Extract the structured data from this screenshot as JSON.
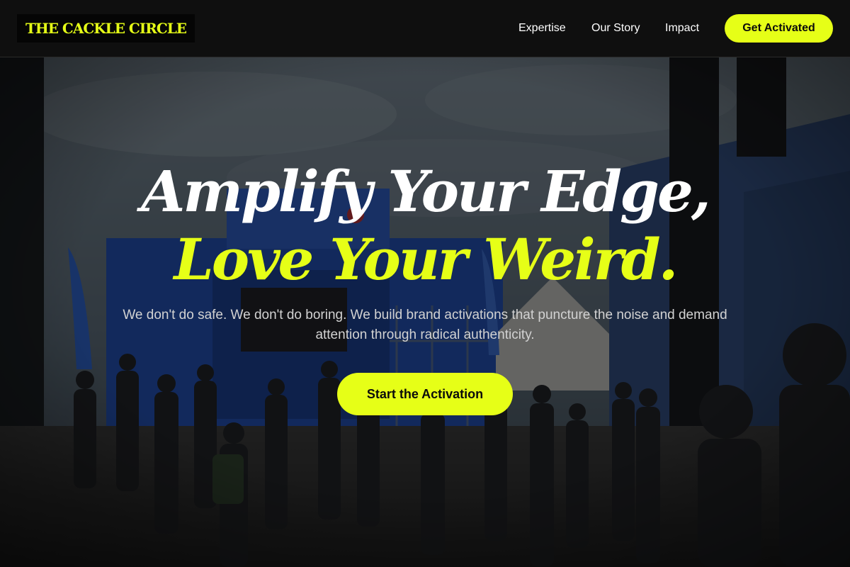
{
  "brand": {
    "name": "THE CACKLE CIRCLE",
    "accent": "#e6ff17",
    "background": "#0b0b0b"
  },
  "nav": {
    "links": [
      {
        "label": "Expertise"
      },
      {
        "label": "Our Story"
      },
      {
        "label": "Impact"
      }
    ],
    "cta_label": "Get Activated"
  },
  "hero": {
    "background_image": "crowd-at-outdoor-brand-activation-event-photo",
    "headline_line1": "Amplify Your Edge,",
    "headline_line2": "Love Your Weird.",
    "subtitle": "We don't do safe. We don't do boring. We build brand activations that puncture the noise and demand attention through radical authenticity.",
    "cta_label": "Start the Activation"
  }
}
